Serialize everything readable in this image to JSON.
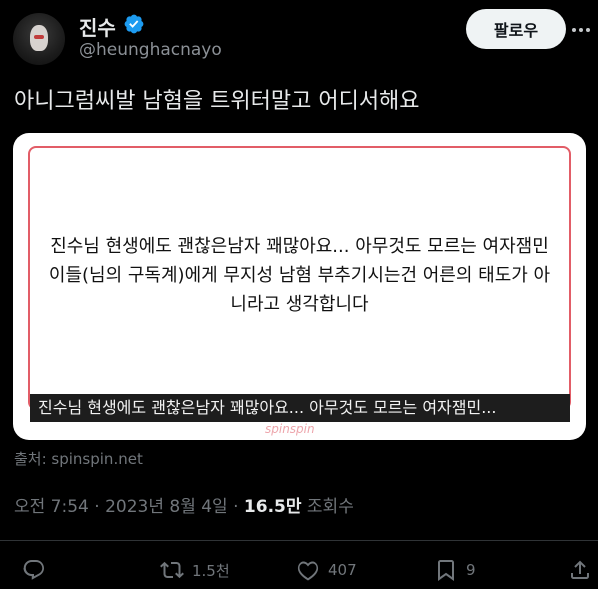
{
  "tweet": {
    "author_name": "진수",
    "author_handle": "@heunghacnayo",
    "follow_label": "팔로우",
    "text": "아니그럼씨발 남혐을 트위터말고 어디서해요",
    "card": {
      "body": "진수님 현생에도 괜찮은남자 꽤많아요... 아무것도 모르는 여자잼민이들(님의 구독계)에게 무지성 남혐 부추기시는건 어른의 태도가 아니라고 생각합니다",
      "caption": "진수님 현생에도 괜찮은남자 꽤많아요... 아무것도 모르는 여자잼민...",
      "watermark": "spinspin"
    },
    "source": "출처: spinspin.net",
    "time": "오전 7:54",
    "date": "2023년 8월 4일",
    "views_count": "16.5만",
    "views_label": "조회수",
    "separator": " · "
  },
  "actions": {
    "reply_icon": "reply-icon",
    "retweet_count": "1.5천",
    "like_count": "407",
    "bookmark_count": "9"
  },
  "colors": {
    "background": "#000000",
    "text": "#e7e9ea",
    "secondary": "#71767b",
    "verified": "#1d9bf0",
    "card_border": "#e25d67"
  }
}
